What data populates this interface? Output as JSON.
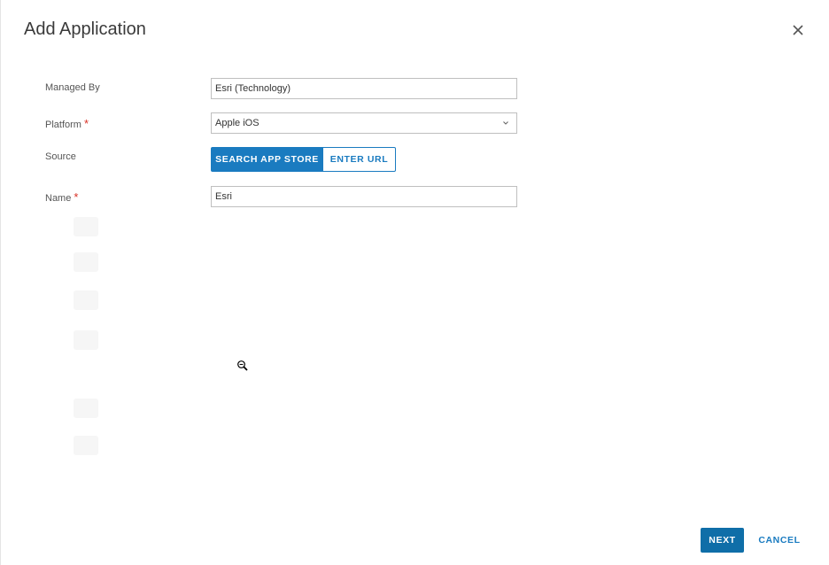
{
  "dialog": {
    "title": "Add Application",
    "close_icon": "close-icon"
  },
  "form": {
    "managed_by": {
      "label": "Managed By",
      "value": "Esri (Technology)"
    },
    "platform": {
      "label": "Platform",
      "required_mark": "*",
      "selected": "Apple iOS",
      "chevron_icon": "chevron-down-icon"
    },
    "source": {
      "label": "Source",
      "options": [
        "SEARCH APP STORE",
        "ENTER URL"
      ],
      "selected": "SEARCH APP STORE"
    },
    "name": {
      "label": "Name",
      "required_mark": "*",
      "value": "Esri"
    }
  },
  "footer": {
    "next_label": "NEXT",
    "cancel_label": "CANCEL"
  },
  "colors": {
    "accent": "#1a7bc0",
    "primary_button": "#0f6ea8",
    "required": "#d93025"
  },
  "cursor": "zoom-out-cursor-icon"
}
